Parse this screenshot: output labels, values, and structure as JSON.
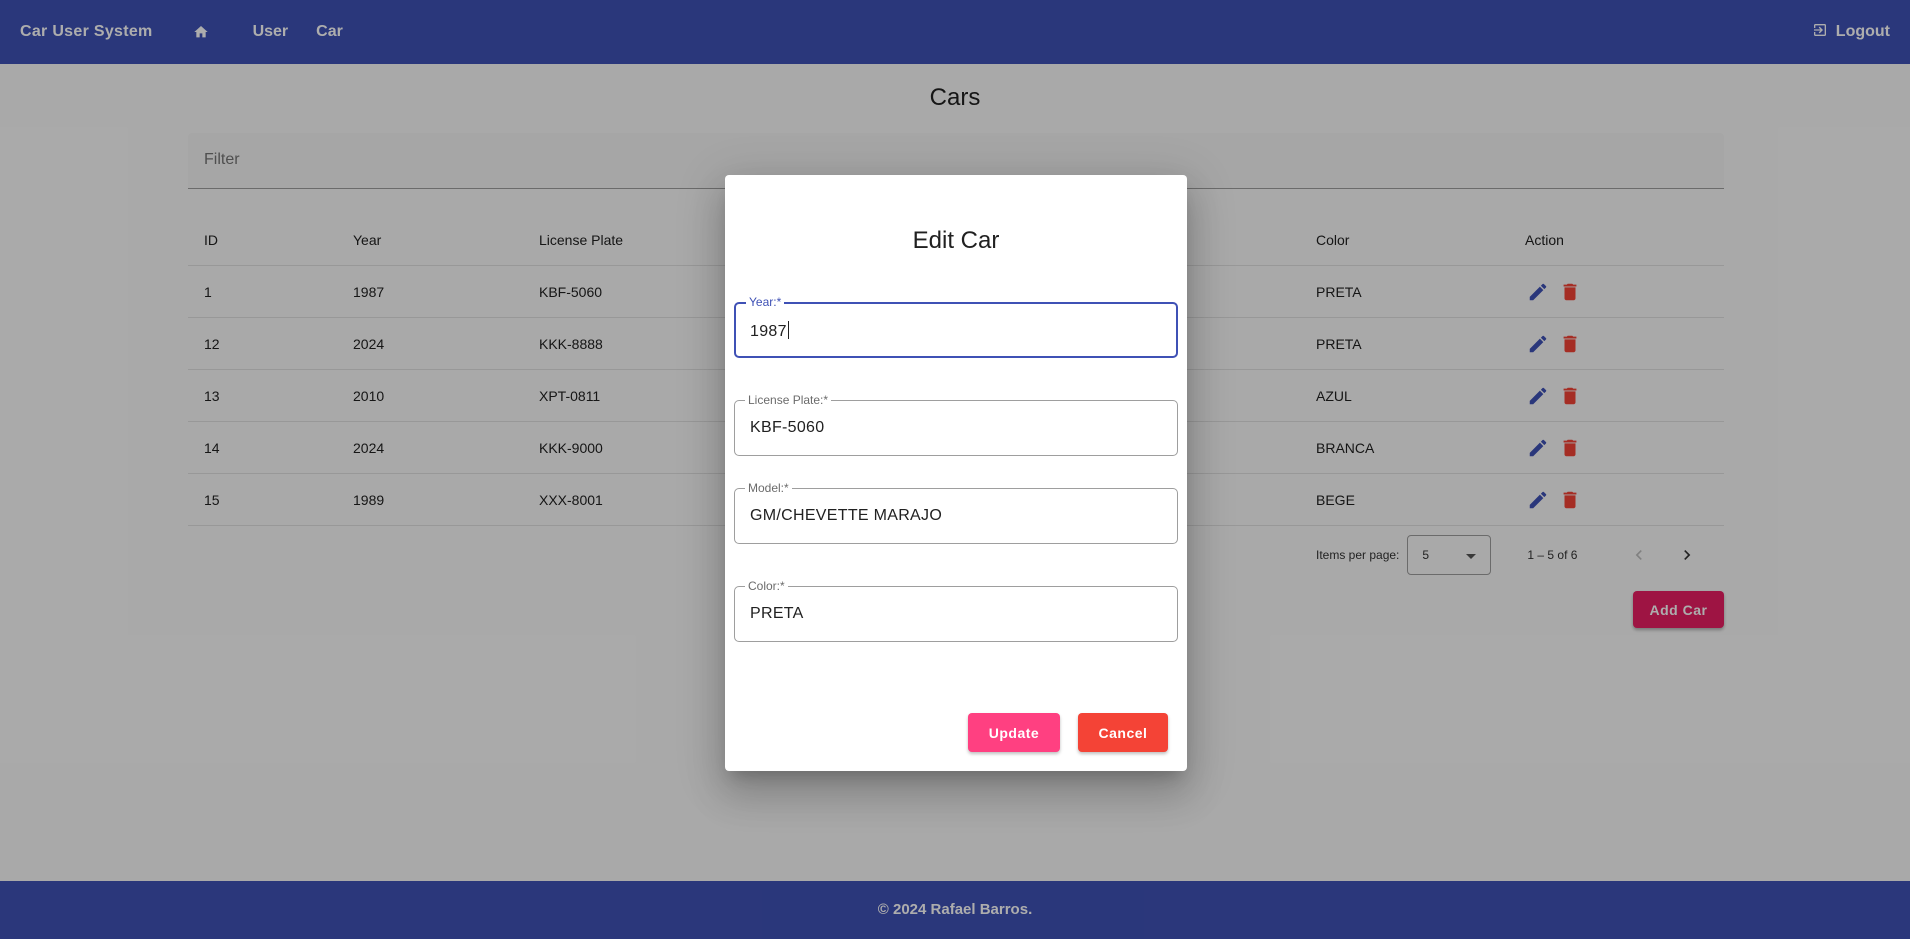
{
  "colors": {
    "primary": "#3f51b5",
    "accent": "#ff4081",
    "add_button": "#e91e63",
    "warn": "#f44336",
    "edit_icon": "#3f51b5",
    "delete_icon": "#f44336"
  },
  "toolbar": {
    "brand": "Car User System",
    "home_icon": "home-icon",
    "nav": [
      {
        "label": "User"
      },
      {
        "label": "Car"
      }
    ],
    "logout_label": "Logout",
    "logout_icon": "logout-icon"
  },
  "page": {
    "title": "Cars",
    "filter_placeholder": "Filter",
    "columns": {
      "id": "ID",
      "year": "Year",
      "plate": "License Plate",
      "color": "Color",
      "action": "Action"
    },
    "rows": [
      {
        "id": "1",
        "year": "1987",
        "plate": "KBF-5060",
        "color": "PRETA"
      },
      {
        "id": "12",
        "year": "2024",
        "plate": "KKK-8888",
        "color": "PRETA"
      },
      {
        "id": "13",
        "year": "2010",
        "plate": "XPT-0811",
        "color": "AZUL"
      },
      {
        "id": "14",
        "year": "2024",
        "plate": "KKK-9000",
        "color": "BRANCA"
      },
      {
        "id": "15",
        "year": "1989",
        "plate": "XXX-8001",
        "color": "BEGE"
      }
    ],
    "paginator": {
      "items_per_page_label": "Items per page:",
      "page_size": "5",
      "range_label": "1 – 5 of 6"
    },
    "add_button": "Add Car"
  },
  "dialog": {
    "title": "Edit Car",
    "fields": [
      {
        "label": "Year:*",
        "value": "1987"
      },
      {
        "label": "License Plate:*",
        "value": "KBF-5060"
      },
      {
        "label": "Model:*",
        "value": "GM/CHEVETTE MARAJO"
      },
      {
        "label": "Color:*",
        "value": "PRETA"
      }
    ],
    "update_label": "Update",
    "cancel_label": "Cancel"
  },
  "footer": {
    "text": "© 2024 Rafael Barros."
  }
}
